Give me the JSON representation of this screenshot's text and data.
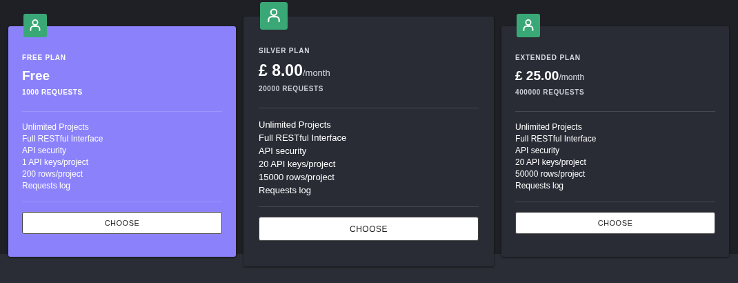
{
  "plans": [
    {
      "name": "FREE PLAN",
      "price": "Free",
      "requests": "1000 REQUESTS",
      "selected": true,
      "featured": false,
      "features": [
        "Unlimited Projects",
        "Full RESTful Interface",
        "API security",
        "1 API keys/project",
        "200 rows/project",
        "Requests log"
      ],
      "button": "CHOOSE"
    },
    {
      "name": "SILVER PLAN",
      "price": "£ 8.00",
      "period": "/month",
      "requests": "20000 REQUESTS",
      "selected": false,
      "featured": true,
      "features": [
        "Unlimited Projects",
        "Full RESTful Interface",
        "API security",
        "20 API keys/project",
        "15000 rows/project",
        "Requests log"
      ],
      "button": "CHOOSE"
    },
    {
      "name": "EXTENDED PLAN",
      "price": "£ 25.00",
      "period": "/month",
      "requests": "400000 REQUESTS",
      "selected": false,
      "featured": false,
      "features": [
        "Unlimited Projects",
        "Full RESTful Interface",
        "API security",
        "20 API keys/project",
        "50000 rows/project",
        "Requests log"
      ],
      "button": "CHOOSE"
    }
  ]
}
